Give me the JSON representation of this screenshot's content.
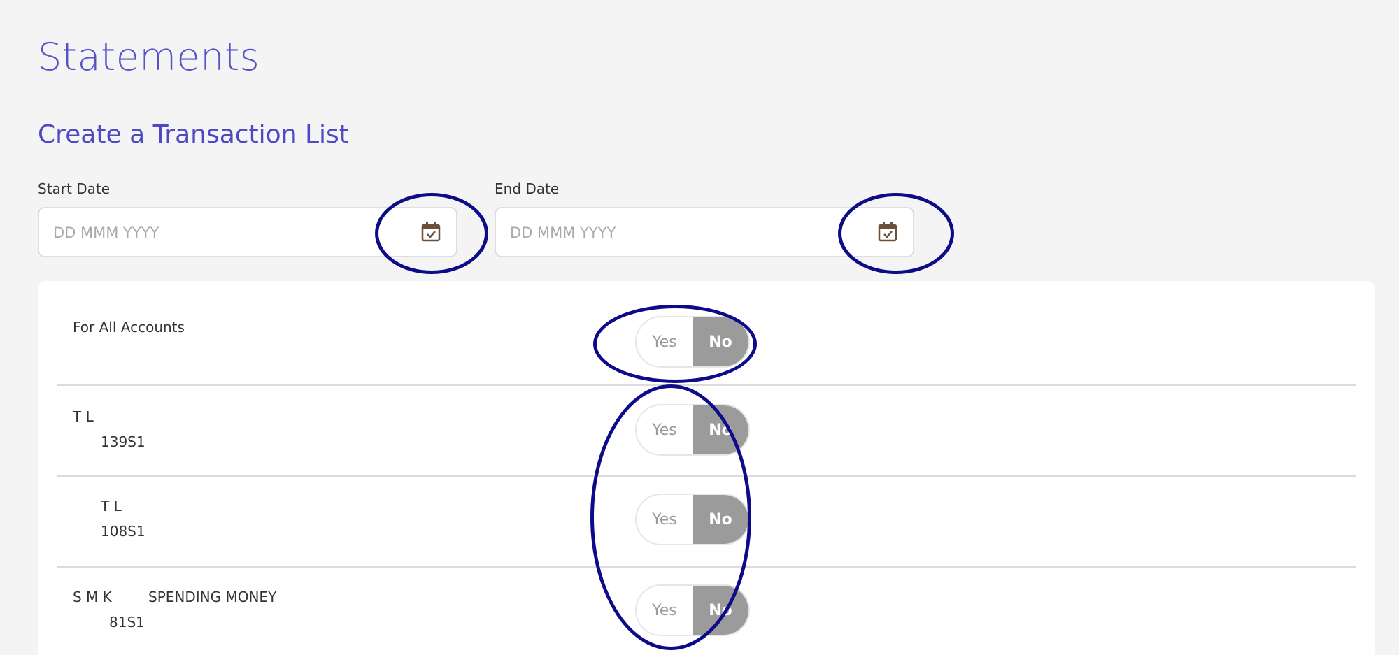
{
  "page": {
    "title": "Statements",
    "section_title": "Create a Transaction List"
  },
  "start_date": {
    "label": "Start Date",
    "placeholder": "DD MMM YYYY",
    "value": "",
    "icon": "calendar-check-icon"
  },
  "end_date": {
    "label": "End Date",
    "placeholder": "DD MMM YYYY",
    "value": "",
    "icon": "calendar-check-icon"
  },
  "all_accounts": {
    "label": "For All Accounts",
    "yes_label": "Yes",
    "no_label": "No",
    "selected": "No"
  },
  "accounts": [
    {
      "name": "T L",
      "number": "139S1",
      "yes_label": "Yes",
      "no_label": "No",
      "selected": "No"
    },
    {
      "name": "T L",
      "number": "108S1",
      "yes_label": "Yes",
      "no_label": "No",
      "selected": "No"
    },
    {
      "name": "S M K",
      "name_suffix": "SPENDING MONEY",
      "number": "81S1",
      "yes_label": "Yes",
      "no_label": "No",
      "selected": "No"
    }
  ],
  "colors": {
    "heading": "#5753c7",
    "annotation": "#0c0c8a",
    "toggle_selected": "#9b9b9b",
    "icon": "#6b4f3a"
  }
}
